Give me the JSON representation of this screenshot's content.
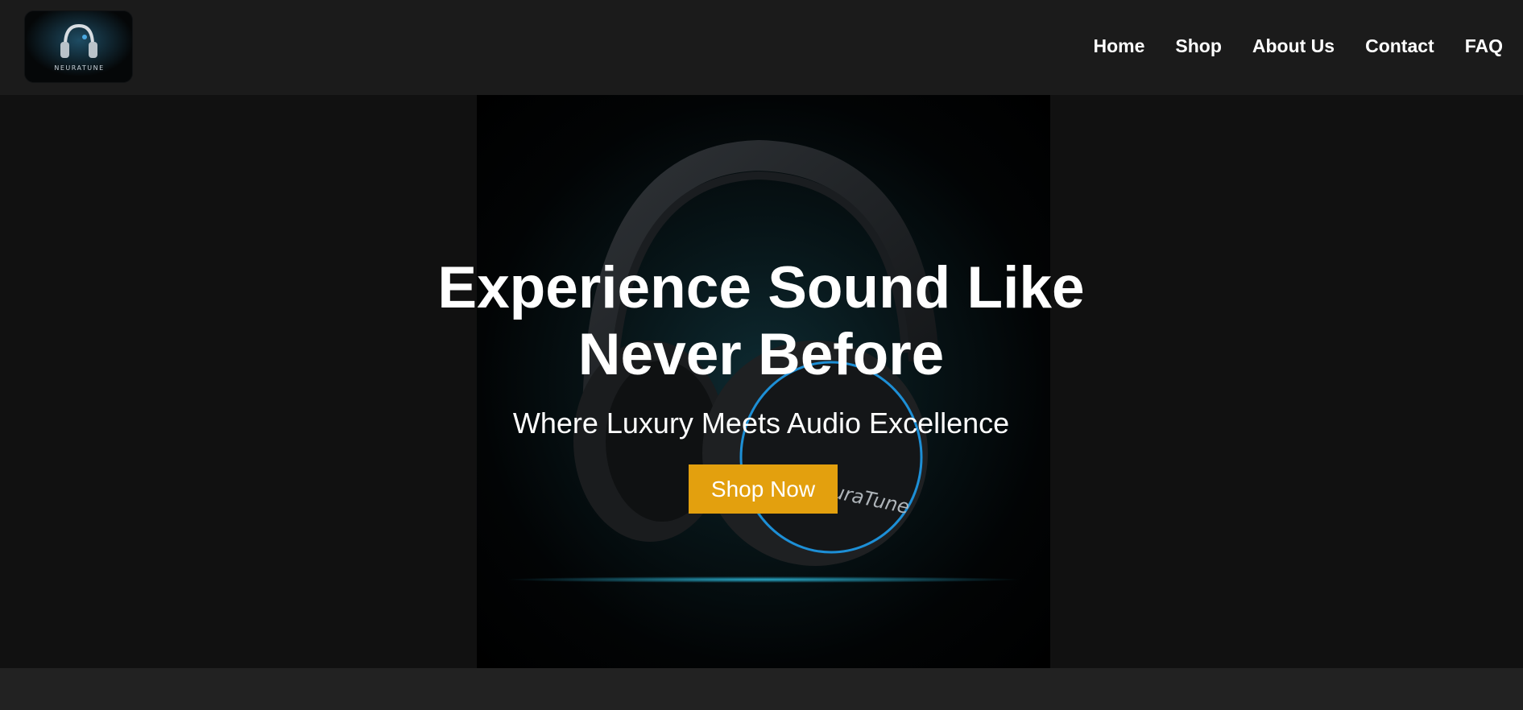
{
  "brand": {
    "logo_text": "NEURATUNE",
    "product_text": "uraTune"
  },
  "nav": {
    "items": [
      {
        "label": "Home"
      },
      {
        "label": "Shop"
      },
      {
        "label": "About Us"
      },
      {
        "label": "Contact"
      },
      {
        "label": "FAQ"
      }
    ]
  },
  "hero": {
    "title_line1": "Experience Sound Like",
    "title_line2": "Never Before",
    "subtitle": "Where Luxury Meets Audio Excellence",
    "cta_label": "Shop Now"
  },
  "colors": {
    "header_bg": "#1b1b1b",
    "hero_bg": "#111111",
    "cta_bg": "#e3a00e",
    "accent_blue": "#1d8fd6"
  },
  "icons": {
    "logo": "headphones-icon",
    "hero_image": "headphones-product-image"
  }
}
